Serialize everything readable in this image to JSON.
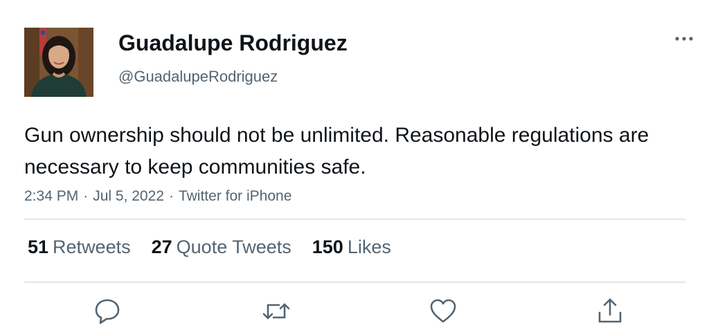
{
  "author": {
    "name": "Guadalupe Rodriguez",
    "handle": "@GuadalupeRodriguez",
    "avatar_icon": "profile-photo"
  },
  "tweet": {
    "text": "Gun ownership should not be unlimited. Reasonable regulations are necessary to keep communities safe.",
    "time": "2:34 PM",
    "date": "Jul 5, 2022",
    "source": "Twitter for iPhone",
    "separator": "·"
  },
  "stats": {
    "retweets": {
      "count": "51",
      "label": "Retweets"
    },
    "quote_tweets": {
      "count": "27",
      "label": "Quote Tweets"
    },
    "likes": {
      "count": "150",
      "label": "Likes"
    }
  },
  "actions": {
    "reply_icon": "reply-icon",
    "retweet_icon": "retweet-icon",
    "like_icon": "heart-icon",
    "share_icon": "share-icon",
    "more_icon": "more-options-icon"
  },
  "colors": {
    "text_primary": "#0f1419",
    "text_secondary": "#536471",
    "divider": "#e3e6e9",
    "icon": "#536471"
  }
}
